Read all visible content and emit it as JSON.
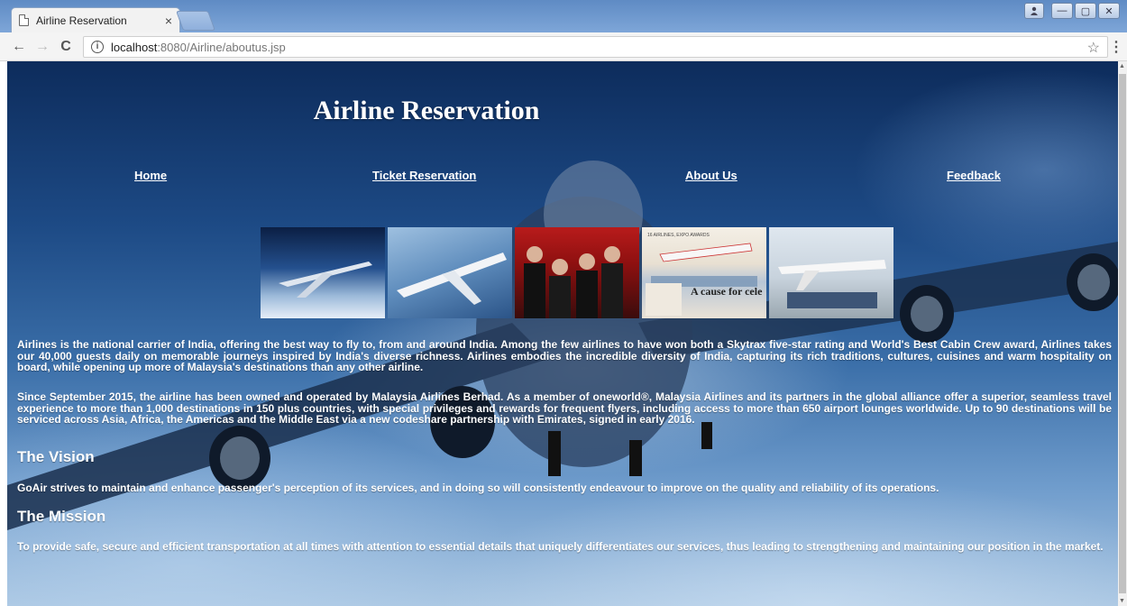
{
  "browser": {
    "tab_title": "Airline Reservation",
    "tab_close": "×",
    "url_host": "localhost",
    "url_path": ":8080/Airline/aboutus.jsp",
    "back": "←",
    "forward": "→",
    "reload": "C",
    "info": "i",
    "star": "☆",
    "menu": "⋮",
    "win": {
      "minimize": "—",
      "maximize": "▢",
      "close": "✕",
      "user": "👤"
    }
  },
  "site": {
    "title": "Airline Reservation",
    "nav": [
      {
        "label": "Home"
      },
      {
        "label": "Ticket Reservation"
      },
      {
        "label": "About Us"
      },
      {
        "label": "Feedback"
      }
    ],
    "gallery": {
      "caption": "A cause for cele",
      "headline": "16 AIRLINES, EXPO AWARDS"
    }
  },
  "content": {
    "p1": "Airlines is the national carrier of India, offering the best way to fly to, from and around India. Among the few airlines to have won both a Skytrax five-star rating and World's Best Cabin Crew award, Airlines takes our 40,000 guests daily on memorable journeys inspired by India's diverse richness. Airlines embodies the incredible diversity of India, capturing its rich traditions, cultures, cuisines and warm hospitality on board, while opening up more of Malaysia's destinations than any other airline.",
    "p2": "Since September 2015, the airline has been owned and operated by Malaysia Airlines Berhad. As a member of oneworld®, Malaysia Airlines and its partners in the global alliance offer a superior, seamless travel experience to more than 1,000 destinations in 150 plus countries, with special privileges and rewards for frequent flyers, including access to more than 650 airport lounges worldwide. Up to 90 destinations will be serviced across Asia, Africa, the Americas and the Middle East via a new codeshare partnership with Emirates, signed in early 2016.",
    "vision_heading": "The Vision",
    "vision": "GoAir strives to maintain and enhance passenger's perception of its services, and in doing so will consistently endeavour to improve on the quality and reliability of its operations.",
    "mission_heading": "The Mission",
    "mission": "To provide safe, secure and efficient transportation at all times with attention to essential details that uniquely differentiates our services, thus leading to strengthening and maintaining our position in the market."
  }
}
